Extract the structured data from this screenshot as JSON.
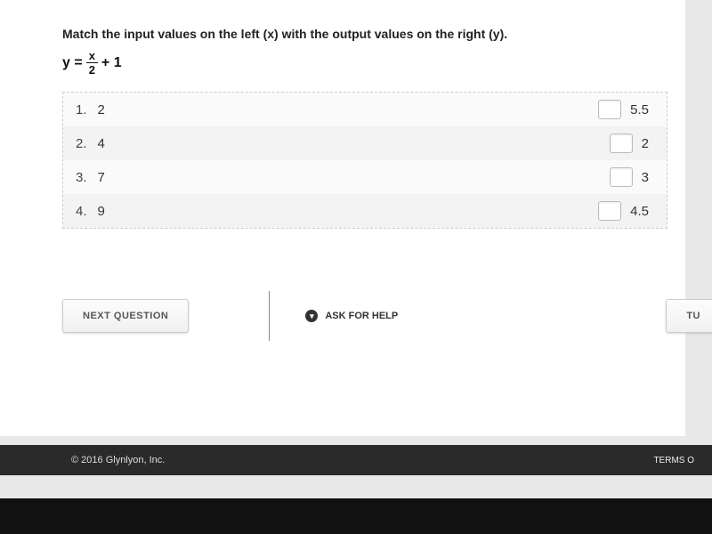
{
  "question": {
    "instruction": "Match the input values on the left (x) with the output values on the right (y).",
    "eq_left": "y =",
    "eq_frac_num": "x",
    "eq_frac_den": "2",
    "eq_right": "+ 1",
    "rows": [
      {
        "n": "1.",
        "x": "2",
        "y": "5.5"
      },
      {
        "n": "2.",
        "x": "4",
        "y": "2"
      },
      {
        "n": "3.",
        "x": "7",
        "y": "3"
      },
      {
        "n": "4.",
        "x": "9",
        "y": "4.5"
      }
    ]
  },
  "buttons": {
    "next": "NEXT QUESTION",
    "help": "ASK FOR HELP",
    "turn": "TU"
  },
  "footer": {
    "copyright": "© 2016 Glynlyon, Inc.",
    "terms": "TERMS O"
  }
}
